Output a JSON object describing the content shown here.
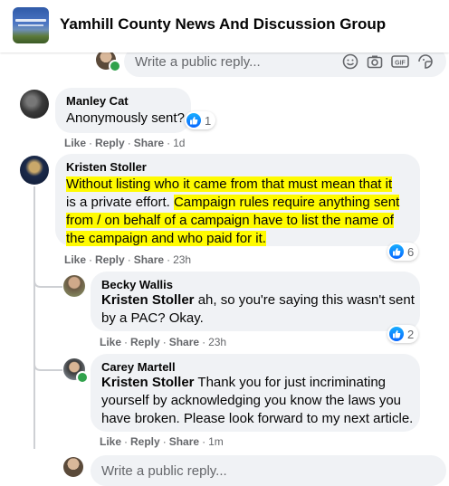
{
  "header": {
    "group_name": "Yamhill County News And Discussion Group"
  },
  "top_reply": {
    "placeholder": "Write a public reply..."
  },
  "comments": [
    {
      "author": "Manley Cat",
      "text": "Anonymously sent?",
      "actions": {
        "like": "Like",
        "reply": "Reply",
        "share": "Share",
        "time": "1d"
      },
      "reactions": "1"
    },
    {
      "author": "Kristen Stoller",
      "text_segments": [
        "Without listing who it came from that must mean that it",
        "is a private effort.",
        "Campaign rules require anything sent",
        "from / on behalf of a campaign have to list the name of",
        "the campaign and who paid for it."
      ],
      "actions": {
        "like": "Like",
        "reply": "Reply",
        "share": "Share",
        "time": "23h"
      },
      "reactions": "6"
    }
  ],
  "replies": [
    {
      "author": "Becky Wallis",
      "mention": "Kristen Stoller",
      "text_line1": " ah, so you're saying this wasn't sent",
      "text_line2": "by a PAC? Okay.",
      "actions": {
        "like": "Like",
        "reply": "Reply",
        "share": "Share",
        "time": "23h"
      },
      "reactions": "2"
    },
    {
      "author": "Carey Martell",
      "mention": "Kristen Stoller",
      "text_line1": " Thank you for just incriminating",
      "text_line2": "yourself by acknowledging you know the laws you",
      "text_line3": "have broken. Please look forward to my next article.",
      "actions": {
        "like": "Like",
        "reply": "Reply",
        "share": "Share",
        "time": "1m"
      }
    }
  ],
  "bottom_reply": {
    "placeholder": "Write a public reply..."
  },
  "colors": {
    "highlight": "#fffb00",
    "like_blue": "#0866ff",
    "online": "#31a24c",
    "bubble": "#f0f2f5"
  },
  "icons": [
    "emoji-icon",
    "camera-icon",
    "gif-icon",
    "sticker-icon",
    "like-reaction-icon"
  ]
}
